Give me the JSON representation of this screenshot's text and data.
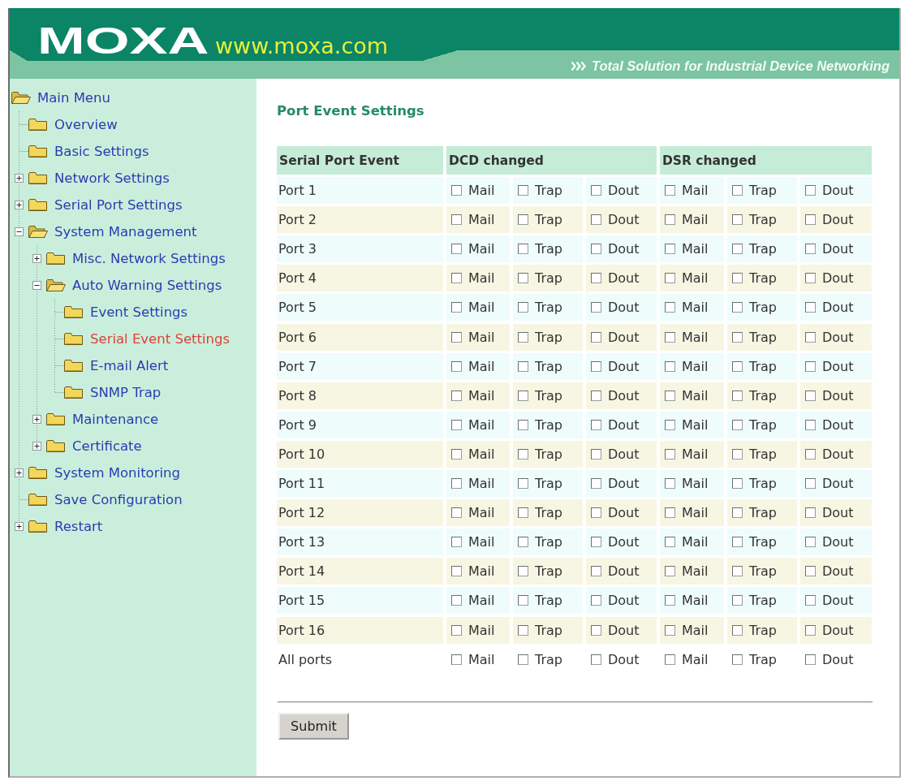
{
  "header": {
    "logo": "MOXA",
    "url": "www.moxa.com",
    "tagline": "Total Solution for Industrial Device Networking"
  },
  "sidebar": {
    "items": [
      {
        "label": "Main Menu",
        "kind": "root",
        "selected": false,
        "children": [
          {
            "label": "Overview",
            "kind": "leaf",
            "selected": false
          },
          {
            "label": "Basic Settings",
            "kind": "leaf",
            "selected": false
          },
          {
            "label": "Network Settings",
            "kind": "branch",
            "expanded": false,
            "selected": false
          },
          {
            "label": "Serial Port Settings",
            "kind": "branch",
            "expanded": false,
            "selected": false
          },
          {
            "label": "System Management",
            "kind": "branch",
            "expanded": true,
            "selected": false,
            "children": [
              {
                "label": "Misc. Network Settings",
                "kind": "branch",
                "expanded": false,
                "selected": false
              },
              {
                "label": "Auto Warning Settings",
                "kind": "branch",
                "expanded": true,
                "selected": false,
                "children": [
                  {
                    "label": "Event Settings",
                    "kind": "leaf",
                    "selected": false
                  },
                  {
                    "label": "Serial Event Settings",
                    "kind": "leaf",
                    "selected": true
                  },
                  {
                    "label": "E-mail Alert",
                    "kind": "leaf",
                    "selected": false
                  },
                  {
                    "label": "SNMP Trap",
                    "kind": "leaf",
                    "selected": false
                  }
                ]
              },
              {
                "label": "Maintenance",
                "kind": "branch",
                "expanded": false,
                "selected": false
              },
              {
                "label": "Certificate",
                "kind": "branch",
                "expanded": false,
                "selected": false
              }
            ]
          },
          {
            "label": "System Monitoring",
            "kind": "branch",
            "expanded": false,
            "selected": false
          },
          {
            "label": "Save Configuration",
            "kind": "leaf",
            "selected": false
          },
          {
            "label": "Restart",
            "kind": "branch",
            "expanded": false,
            "selected": false
          }
        ]
      }
    ]
  },
  "main": {
    "title": "Port Event Settings",
    "table": {
      "columns": {
        "first": "Serial Port Event",
        "groups": [
          "DCD changed",
          "DSR changed"
        ]
      },
      "rows": [
        {
          "port": "Port 1",
          "events": [
            [
              {
                "label": "Mail",
                "checked": false
              },
              {
                "label": "Trap",
                "checked": false
              },
              {
                "label": "Dout",
                "checked": false
              }
            ],
            [
              {
                "label": "Mail",
                "checked": false
              },
              {
                "label": "Trap",
                "checked": false
              },
              {
                "label": "Dout",
                "checked": false
              }
            ]
          ]
        },
        {
          "port": "Port 2",
          "events": [
            [
              {
                "label": "Mail",
                "checked": false
              },
              {
                "label": "Trap",
                "checked": false
              },
              {
                "label": "Dout",
                "checked": false
              }
            ],
            [
              {
                "label": "Mail",
                "checked": false
              },
              {
                "label": "Trap",
                "checked": false
              },
              {
                "label": "Dout",
                "checked": false
              }
            ]
          ]
        },
        {
          "port": "Port 3",
          "events": [
            [
              {
                "label": "Mail",
                "checked": false
              },
              {
                "label": "Trap",
                "checked": false
              },
              {
                "label": "Dout",
                "checked": false
              }
            ],
            [
              {
                "label": "Mail",
                "checked": false
              },
              {
                "label": "Trap",
                "checked": false
              },
              {
                "label": "Dout",
                "checked": false
              }
            ]
          ]
        },
        {
          "port": "Port 4",
          "events": [
            [
              {
                "label": "Mail",
                "checked": false
              },
              {
                "label": "Trap",
                "checked": false
              },
              {
                "label": "Dout",
                "checked": false
              }
            ],
            [
              {
                "label": "Mail",
                "checked": false
              },
              {
                "label": "Trap",
                "checked": false
              },
              {
                "label": "Dout",
                "checked": false
              }
            ]
          ]
        },
        {
          "port": "Port 5",
          "events": [
            [
              {
                "label": "Mail",
                "checked": false
              },
              {
                "label": "Trap",
                "checked": false
              },
              {
                "label": "Dout",
                "checked": false
              }
            ],
            [
              {
                "label": "Mail",
                "checked": false
              },
              {
                "label": "Trap",
                "checked": false
              },
              {
                "label": "Dout",
                "checked": false
              }
            ]
          ]
        },
        {
          "port": "Port 6",
          "events": [
            [
              {
                "label": "Mail",
                "checked": false
              },
              {
                "label": "Trap",
                "checked": false
              },
              {
                "label": "Dout",
                "checked": false
              }
            ],
            [
              {
                "label": "Mail",
                "checked": false
              },
              {
                "label": "Trap",
                "checked": false
              },
              {
                "label": "Dout",
                "checked": false
              }
            ]
          ]
        },
        {
          "port": "Port 7",
          "events": [
            [
              {
                "label": "Mail",
                "checked": false
              },
              {
                "label": "Trap",
                "checked": false
              },
              {
                "label": "Dout",
                "checked": false
              }
            ],
            [
              {
                "label": "Mail",
                "checked": false
              },
              {
                "label": "Trap",
                "checked": false
              },
              {
                "label": "Dout",
                "checked": false
              }
            ]
          ]
        },
        {
          "port": "Port 8",
          "events": [
            [
              {
                "label": "Mail",
                "checked": false
              },
              {
                "label": "Trap",
                "checked": false
              },
              {
                "label": "Dout",
                "checked": false
              }
            ],
            [
              {
                "label": "Mail",
                "checked": false
              },
              {
                "label": "Trap",
                "checked": false
              },
              {
                "label": "Dout",
                "checked": false
              }
            ]
          ]
        },
        {
          "port": "Port 9",
          "events": [
            [
              {
                "label": "Mail",
                "checked": false
              },
              {
                "label": "Trap",
                "checked": false
              },
              {
                "label": "Dout",
                "checked": false
              }
            ],
            [
              {
                "label": "Mail",
                "checked": false
              },
              {
                "label": "Trap",
                "checked": false
              },
              {
                "label": "Dout",
                "checked": false
              }
            ]
          ]
        },
        {
          "port": "Port 10",
          "events": [
            [
              {
                "label": "Mail",
                "checked": false
              },
              {
                "label": "Trap",
                "checked": false
              },
              {
                "label": "Dout",
                "checked": false
              }
            ],
            [
              {
                "label": "Mail",
                "checked": false
              },
              {
                "label": "Trap",
                "checked": false
              },
              {
                "label": "Dout",
                "checked": false
              }
            ]
          ]
        },
        {
          "port": "Port 11",
          "events": [
            [
              {
                "label": "Mail",
                "checked": false
              },
              {
                "label": "Trap",
                "checked": false
              },
              {
                "label": "Dout",
                "checked": false
              }
            ],
            [
              {
                "label": "Mail",
                "checked": false
              },
              {
                "label": "Trap",
                "checked": false
              },
              {
                "label": "Dout",
                "checked": false
              }
            ]
          ]
        },
        {
          "port": "Port 12",
          "events": [
            [
              {
                "label": "Mail",
                "checked": false
              },
              {
                "label": "Trap",
                "checked": false
              },
              {
                "label": "Dout",
                "checked": false
              }
            ],
            [
              {
                "label": "Mail",
                "checked": false
              },
              {
                "label": "Trap",
                "checked": false
              },
              {
                "label": "Dout",
                "checked": false
              }
            ]
          ]
        },
        {
          "port": "Port 13",
          "events": [
            [
              {
                "label": "Mail",
                "checked": false
              },
              {
                "label": "Trap",
                "checked": false
              },
              {
                "label": "Dout",
                "checked": false
              }
            ],
            [
              {
                "label": "Mail",
                "checked": false
              },
              {
                "label": "Trap",
                "checked": false
              },
              {
                "label": "Dout",
                "checked": false
              }
            ]
          ]
        },
        {
          "port": "Port 14",
          "events": [
            [
              {
                "label": "Mail",
                "checked": false
              },
              {
                "label": "Trap",
                "checked": false
              },
              {
                "label": "Dout",
                "checked": false
              }
            ],
            [
              {
                "label": "Mail",
                "checked": false
              },
              {
                "label": "Trap",
                "checked": false
              },
              {
                "label": "Dout",
                "checked": false
              }
            ]
          ]
        },
        {
          "port": "Port 15",
          "events": [
            [
              {
                "label": "Mail",
                "checked": false
              },
              {
                "label": "Trap",
                "checked": false
              },
              {
                "label": "Dout",
                "checked": false
              }
            ],
            [
              {
                "label": "Mail",
                "checked": false
              },
              {
                "label": "Trap",
                "checked": false
              },
              {
                "label": "Dout",
                "checked": false
              }
            ]
          ]
        },
        {
          "port": "Port 16",
          "events": [
            [
              {
                "label": "Mail",
                "checked": false
              },
              {
                "label": "Trap",
                "checked": false
              },
              {
                "label": "Dout",
                "checked": false
              }
            ],
            [
              {
                "label": "Mail",
                "checked": false
              },
              {
                "label": "Trap",
                "checked": false
              },
              {
                "label": "Dout",
                "checked": false
              }
            ]
          ]
        }
      ],
      "all_ports_row": {
        "port": "All ports",
        "events": [
          [
            {
              "label": "Mail",
              "checked": false
            },
            {
              "label": "Trap",
              "checked": false
            },
            {
              "label": "Dout",
              "checked": false
            }
          ],
          [
            {
              "label": "Mail",
              "checked": false
            },
            {
              "label": "Trap",
              "checked": false
            },
            {
              "label": "Dout",
              "checked": false
            }
          ]
        ]
      }
    },
    "submit_button": "Submit"
  }
}
